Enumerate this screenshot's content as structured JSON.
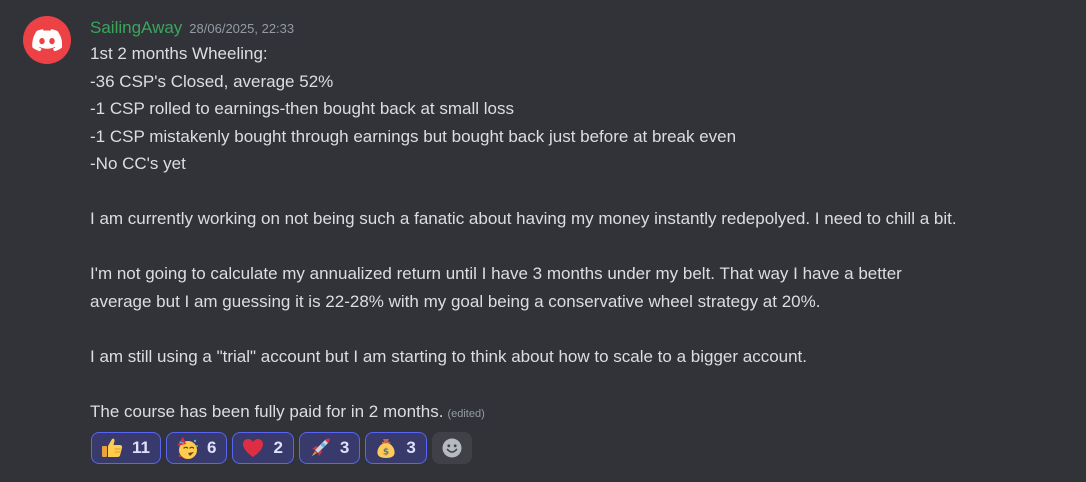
{
  "message": {
    "username": "SailingAway",
    "timestamp": "28/06/2025, 22:33",
    "lines": [
      "1st 2 months Wheeling:",
      "-36 CSP's Closed, average 52%",
      "-1 CSP rolled to earnings-then bought back at small loss",
      "-1 CSP mistakenly bought through earnings but bought back just before at break even",
      "-No CC's yet",
      "I am currently working on not being such a fanatic about having my money instantly redepolyed.  I need to chill a bit.",
      "I'm not going to calculate my annualized return until I have 3 months under my belt.  That way I have a better",
      "average but I am guessing it is 22-28% with my goal being a conservative wheel strategy at 20%.",
      "I am still using a \"trial\" account but I am starting to think about how to scale to a bigger account.",
      "The course has been fully paid for in 2 months."
    ],
    "edited_label": "(edited)"
  },
  "reactions": [
    {
      "emoji": "thumbs-up-icon",
      "count": "11"
    },
    {
      "emoji": "partying-face-icon",
      "count": "6"
    },
    {
      "emoji": "heart-icon",
      "count": "2"
    },
    {
      "emoji": "rocket-icon",
      "count": "3"
    },
    {
      "emoji": "money-bag-icon",
      "count": "3"
    }
  ],
  "colors": {
    "background": "#313338",
    "username": "#3ba55c",
    "avatar": "#ed4245",
    "reaction_border": "#5865f2"
  }
}
